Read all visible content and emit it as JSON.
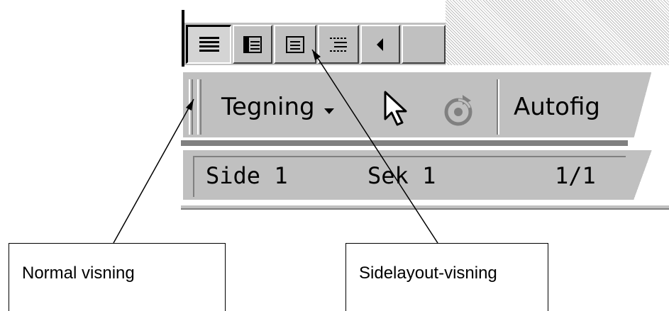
{
  "view_buttons": [
    {
      "name": "normal-view-button",
      "icon": "normal-view-icon",
      "pressed": true
    },
    {
      "name": "web-layout-view-button",
      "icon": "web-layout-icon",
      "pressed": false
    },
    {
      "name": "page-layout-view-button",
      "icon": "page-layout-icon",
      "pressed": false
    },
    {
      "name": "outline-view-button",
      "icon": "outline-view-icon",
      "pressed": false
    },
    {
      "name": "scroll-left-button",
      "icon": "triangle-left-icon",
      "pressed": false
    }
  ],
  "drawing_toolbar": {
    "drawing_label": "Tegning",
    "drawing_dropdown_icon": "triangle-down-icon",
    "select_icon": "cursor-arrow-icon",
    "rotate_icon": "free-rotate-icon",
    "autoshapes_label": "Autofig"
  },
  "status_bar": {
    "page": "Side 1",
    "section": "Sek 1",
    "page_count": "1/1"
  },
  "callouts": {
    "normal": "Normal visning",
    "page_layout": "Sidelayout-visning"
  }
}
